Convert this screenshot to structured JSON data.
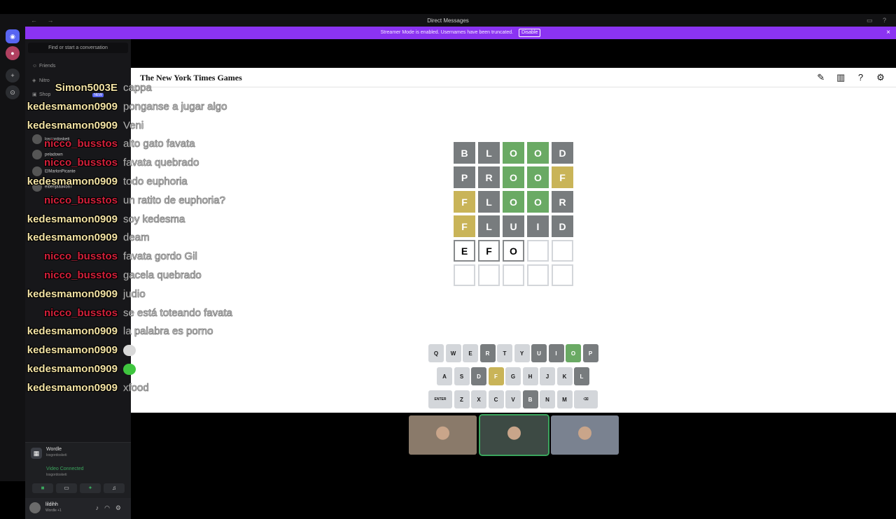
{
  "window": {
    "title": "Direct Messages",
    "nav": "← →",
    "controls": "▭ ?"
  },
  "banner": {
    "text": "Streamer Mode is enabled. Usernames have been truncated.",
    "disable": "Disable",
    "close": "×"
  },
  "sidebar": {
    "find": "Find or start a conversation",
    "links": [
      "Friends",
      "Nitro",
      "Shop"
    ],
    "new_badge": "NEW",
    "dms": [
      {
        "name": "losgordosketi",
        "sub": "Member"
      },
      {
        "name": "peladown",
        "sub": "Wordle +1"
      },
      {
        "name": "ElMarlonPicante",
        "sub": "SIUL"
      },
      {
        "name": "elbenjaaa4567",
        "sub": ""
      }
    ]
  },
  "rtc": {
    "activity": "Wordle",
    "activity_sub": "losgordosketi",
    "status": "Video Connected",
    "status_sub": "losgordosketi"
  },
  "user": {
    "name": "lildihh",
    "status": "Wordle +1"
  },
  "nyt": {
    "logo": "The New York Times Games",
    "icons": [
      "lightbulb-icon",
      "stats-icon",
      "help-icon",
      "settings-icon"
    ]
  },
  "board": {
    "rows": [
      [
        {
          "l": "B",
          "s": "absent"
        },
        {
          "l": "L",
          "s": "absent"
        },
        {
          "l": "O",
          "s": "correct"
        },
        {
          "l": "O",
          "s": "correct"
        },
        {
          "l": "D",
          "s": "absent"
        }
      ],
      [
        {
          "l": "P",
          "s": "absent"
        },
        {
          "l": "R",
          "s": "absent"
        },
        {
          "l": "O",
          "s": "correct"
        },
        {
          "l": "O",
          "s": "correct"
        },
        {
          "l": "F",
          "s": "present"
        }
      ],
      [
        {
          "l": "F",
          "s": "present"
        },
        {
          "l": "L",
          "s": "absent"
        },
        {
          "l": "O",
          "s": "correct"
        },
        {
          "l": "O",
          "s": "correct"
        },
        {
          "l": "R",
          "s": "absent"
        }
      ],
      [
        {
          "l": "F",
          "s": "present"
        },
        {
          "l": "L",
          "s": "absent"
        },
        {
          "l": "U",
          "s": "absent"
        },
        {
          "l": "I",
          "s": "absent"
        },
        {
          "l": "D",
          "s": "absent"
        }
      ],
      [
        {
          "l": "E",
          "s": "tbd"
        },
        {
          "l": "F",
          "s": "tbd"
        },
        {
          "l": "O",
          "s": "tbd"
        },
        {
          "l": "",
          "s": "empty"
        },
        {
          "l": "",
          "s": "empty"
        }
      ],
      [
        {
          "l": "",
          "s": "empty"
        },
        {
          "l": "",
          "s": "empty"
        },
        {
          "l": "",
          "s": "empty"
        },
        {
          "l": "",
          "s": "empty"
        },
        {
          "l": "",
          "s": "empty"
        }
      ]
    ]
  },
  "keyboard": {
    "rows": [
      [
        {
          "k": "Q",
          "s": ""
        },
        {
          "k": "W",
          "s": ""
        },
        {
          "k": "E",
          "s": ""
        },
        {
          "k": "R",
          "s": "absent"
        },
        {
          "k": "T",
          "s": ""
        },
        {
          "k": "Y",
          "s": ""
        },
        {
          "k": "U",
          "s": "absent"
        },
        {
          "k": "I",
          "s": "absent"
        },
        {
          "k": "O",
          "s": "correct"
        },
        {
          "k": "P",
          "s": "absent"
        }
      ],
      [
        {
          "k": "A",
          "s": ""
        },
        {
          "k": "S",
          "s": ""
        },
        {
          "k": "D",
          "s": "absent"
        },
        {
          "k": "F",
          "s": "present"
        },
        {
          "k": "G",
          "s": ""
        },
        {
          "k": "H",
          "s": ""
        },
        {
          "k": "J",
          "s": ""
        },
        {
          "k": "K",
          "s": ""
        },
        {
          "k": "L",
          "s": "absent"
        }
      ],
      [
        {
          "k": "ENTER",
          "s": "",
          "wide": true
        },
        {
          "k": "Z",
          "s": ""
        },
        {
          "k": "X",
          "s": ""
        },
        {
          "k": "C",
          "s": ""
        },
        {
          "k": "V",
          "s": ""
        },
        {
          "k": "B",
          "s": "absent"
        },
        {
          "k": "N",
          "s": ""
        },
        {
          "k": "M",
          "s": ""
        },
        {
          "k": "⌫",
          "s": "",
          "wide": true
        }
      ]
    ]
  },
  "chat": [
    {
      "user": "Simon5003E",
      "cls": "simon",
      "msg": "cappa"
    },
    {
      "user": "kedesmamon0909",
      "cls": "kedes",
      "msg": "ponganse a jugar algo"
    },
    {
      "user": "kedesmamon0909",
      "cls": "kedes",
      "msg": "Veni"
    },
    {
      "user": "nicco_busstos",
      "cls": "nicco",
      "msg": "alto gato favata"
    },
    {
      "user": "nicco_busstos",
      "cls": "nicco",
      "msg": "favata quebrado"
    },
    {
      "user": "kedesmamon0909",
      "cls": "kedes",
      "msg": "todo euphoria"
    },
    {
      "user": "nicco_busstos",
      "cls": "nicco",
      "msg": "un ratito de euphoria?"
    },
    {
      "user": "kedesmamon0909",
      "cls": "kedes",
      "msg": "soy kedesma"
    },
    {
      "user": "kedesmamon0909",
      "cls": "kedes",
      "msg": "deam"
    },
    {
      "user": "nicco_busstos",
      "cls": "nicco",
      "msg": "favata gordo Gil"
    },
    {
      "user": "nicco_busstos",
      "cls": "nicco",
      "msg": "gacela quebrado"
    },
    {
      "user": "kedesmamon0909",
      "cls": "kedes",
      "msg": "judio"
    },
    {
      "user": "nicco_busstos",
      "cls": "nicco",
      "msg": "se está toteando favata"
    },
    {
      "user": "kedesmamon0909",
      "cls": "kedes",
      "msg": "la palabra es porno"
    },
    {
      "user": "kedesmamon0909",
      "cls": "kedes",
      "msg": "",
      "emote": "#d8d8d8"
    },
    {
      "user": "kedesmamon0909",
      "cls": "kedes",
      "msg": "",
      "emote": "#3fc53f"
    },
    {
      "user": "kedesmamon0909",
      "cls": "kedes",
      "msg": "xfood"
    }
  ],
  "cams": [
    {
      "name": "webcam-1",
      "color": "#8a7a6a"
    },
    {
      "name": "webcam-2",
      "color": "#3d4a44"
    },
    {
      "name": "webcam-3",
      "color": "#7a8290"
    }
  ]
}
